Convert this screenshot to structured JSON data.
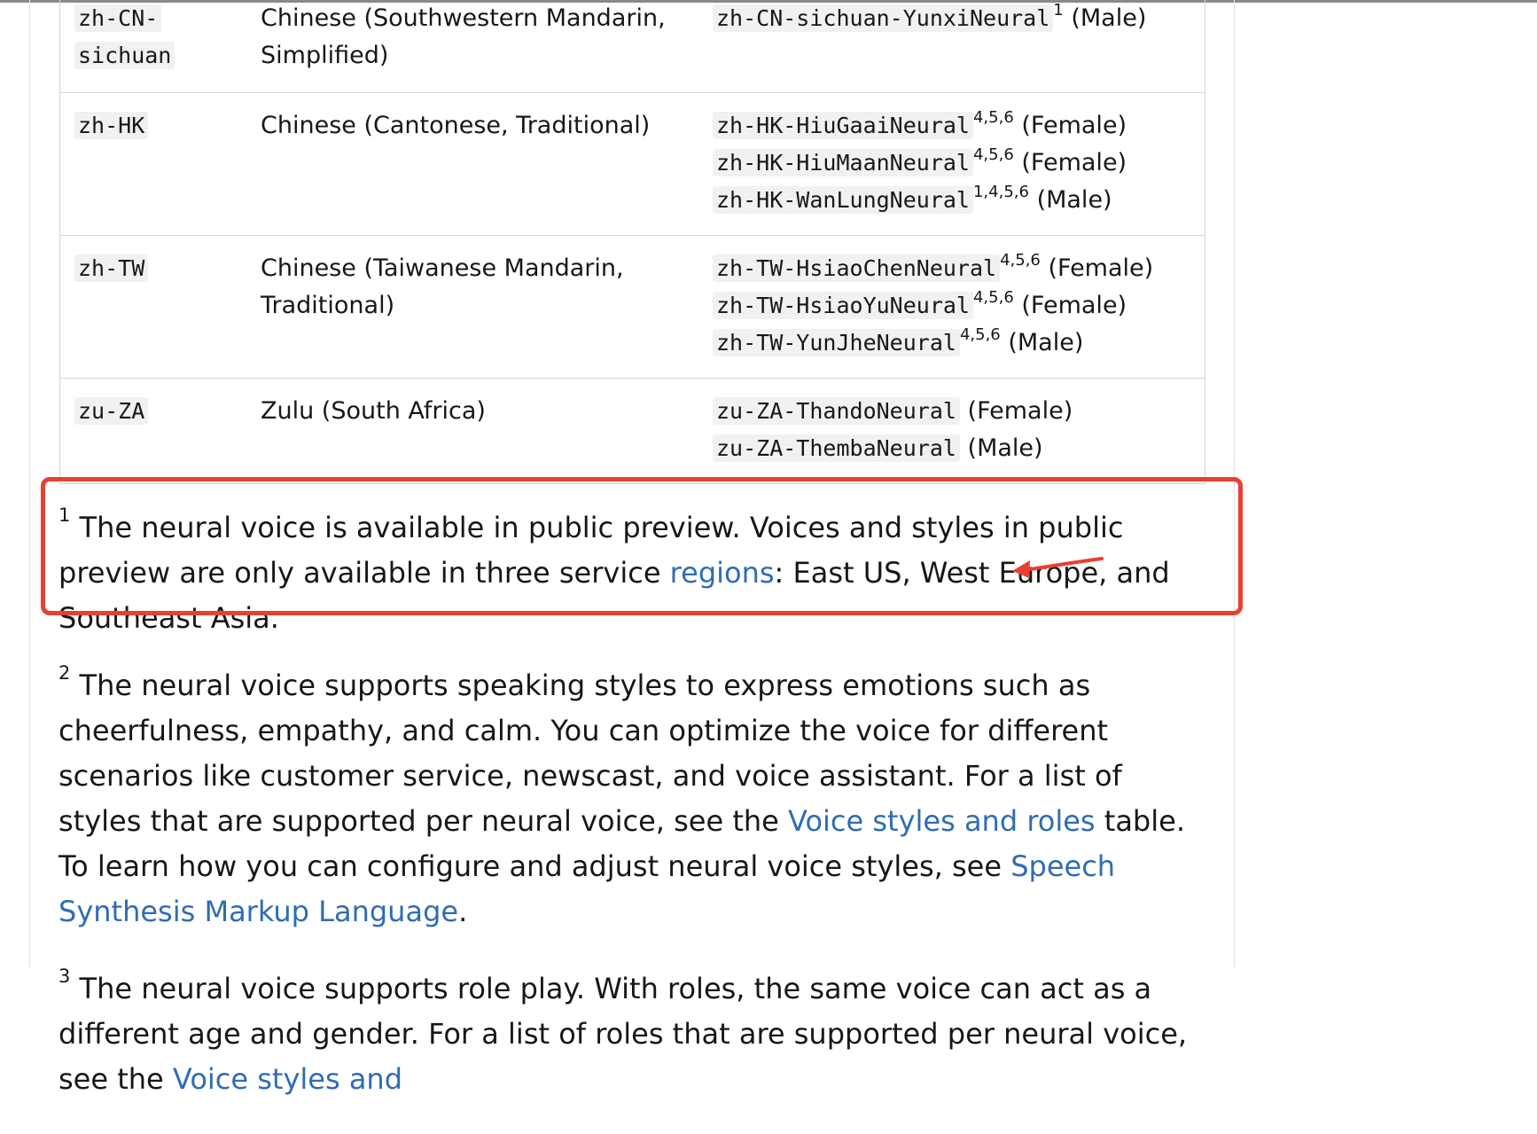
{
  "table": {
    "rows": [
      {
        "locale_lines": [
          "zh-CN-",
          "sichuan"
        ],
        "language_lines": [
          "Chinese (Southwestern Mandarin,",
          "Simplified)"
        ],
        "voices": [
          {
            "name": "zh-CN-sichuan-YunxiNeural",
            "sup": "1",
            "gender": "(Male)"
          }
        ]
      },
      {
        "locale_lines": [
          "zh-HK"
        ],
        "language_lines": [
          "Chinese (Cantonese, Traditional)"
        ],
        "voices": [
          {
            "name": "zh-HK-HiuGaaiNeural",
            "sup": "4,5,6",
            "gender": "(Female)"
          },
          {
            "name": "zh-HK-HiuMaanNeural",
            "sup": "4,5,6",
            "gender": "(Female)"
          },
          {
            "name": "zh-HK-WanLungNeural",
            "sup": "1,4,5,6",
            "gender": "(Male)"
          }
        ]
      },
      {
        "locale_lines": [
          "zh-TW"
        ],
        "language_lines": [
          "Chinese (Taiwanese Mandarin,",
          "Traditional)"
        ],
        "voices": [
          {
            "name": "zh-TW-HsiaoChenNeural",
            "sup": "4,5,6",
            "gender": "(Female)"
          },
          {
            "name": "zh-TW-HsiaoYuNeural",
            "sup": "4,5,6",
            "gender": "(Female)"
          },
          {
            "name": "zh-TW-YunJheNeural",
            "sup": "4,5,6",
            "gender": "(Male)"
          }
        ]
      },
      {
        "locale_lines": [
          "zu-ZA"
        ],
        "language_lines": [
          "Zulu (South Africa)"
        ],
        "voices": [
          {
            "name": "zu-ZA-ThandoNeural",
            "sup": "",
            "gender": "(Female)"
          },
          {
            "name": "zu-ZA-ThembaNeural",
            "sup": "",
            "gender": "(Male)"
          }
        ]
      }
    ]
  },
  "footnotes": [
    {
      "num": "1",
      "parts": [
        {
          "text": "The neural voice is available in public preview. Voices and styles in public preview are only available in three service "
        },
        {
          "text": "regions",
          "link": true
        },
        {
          "text": ": East US, West Europe, and Southeast Asia."
        }
      ]
    },
    {
      "num": "2",
      "parts": [
        {
          "text": "The neural voice supports speaking styles to express emotions such as cheerfulness, empathy, and calm. You can optimize the voice for different scenarios like customer service, newscast, and voice assistant. For a list of styles that are supported per neural voice, see the "
        },
        {
          "text": "Voice styles and roles",
          "link": true
        },
        {
          "text": " table. To learn how you can configure and adjust neural voice styles, see "
        },
        {
          "text": "Speech Synthesis Markup Language",
          "link": true
        },
        {
          "text": "."
        }
      ]
    },
    {
      "num": "3",
      "parts": [
        {
          "text": "The neural voice supports role play. With roles, the same voice can act as a different age and gender. For a list of roles that are supported per neural voice, see the "
        },
        {
          "text": "Voice styles and",
          "link": true
        }
      ]
    }
  ],
  "colors": {
    "link": "#2f6cb4",
    "highlight": "#ea3f33",
    "code_bg": "#f1f1f1"
  }
}
